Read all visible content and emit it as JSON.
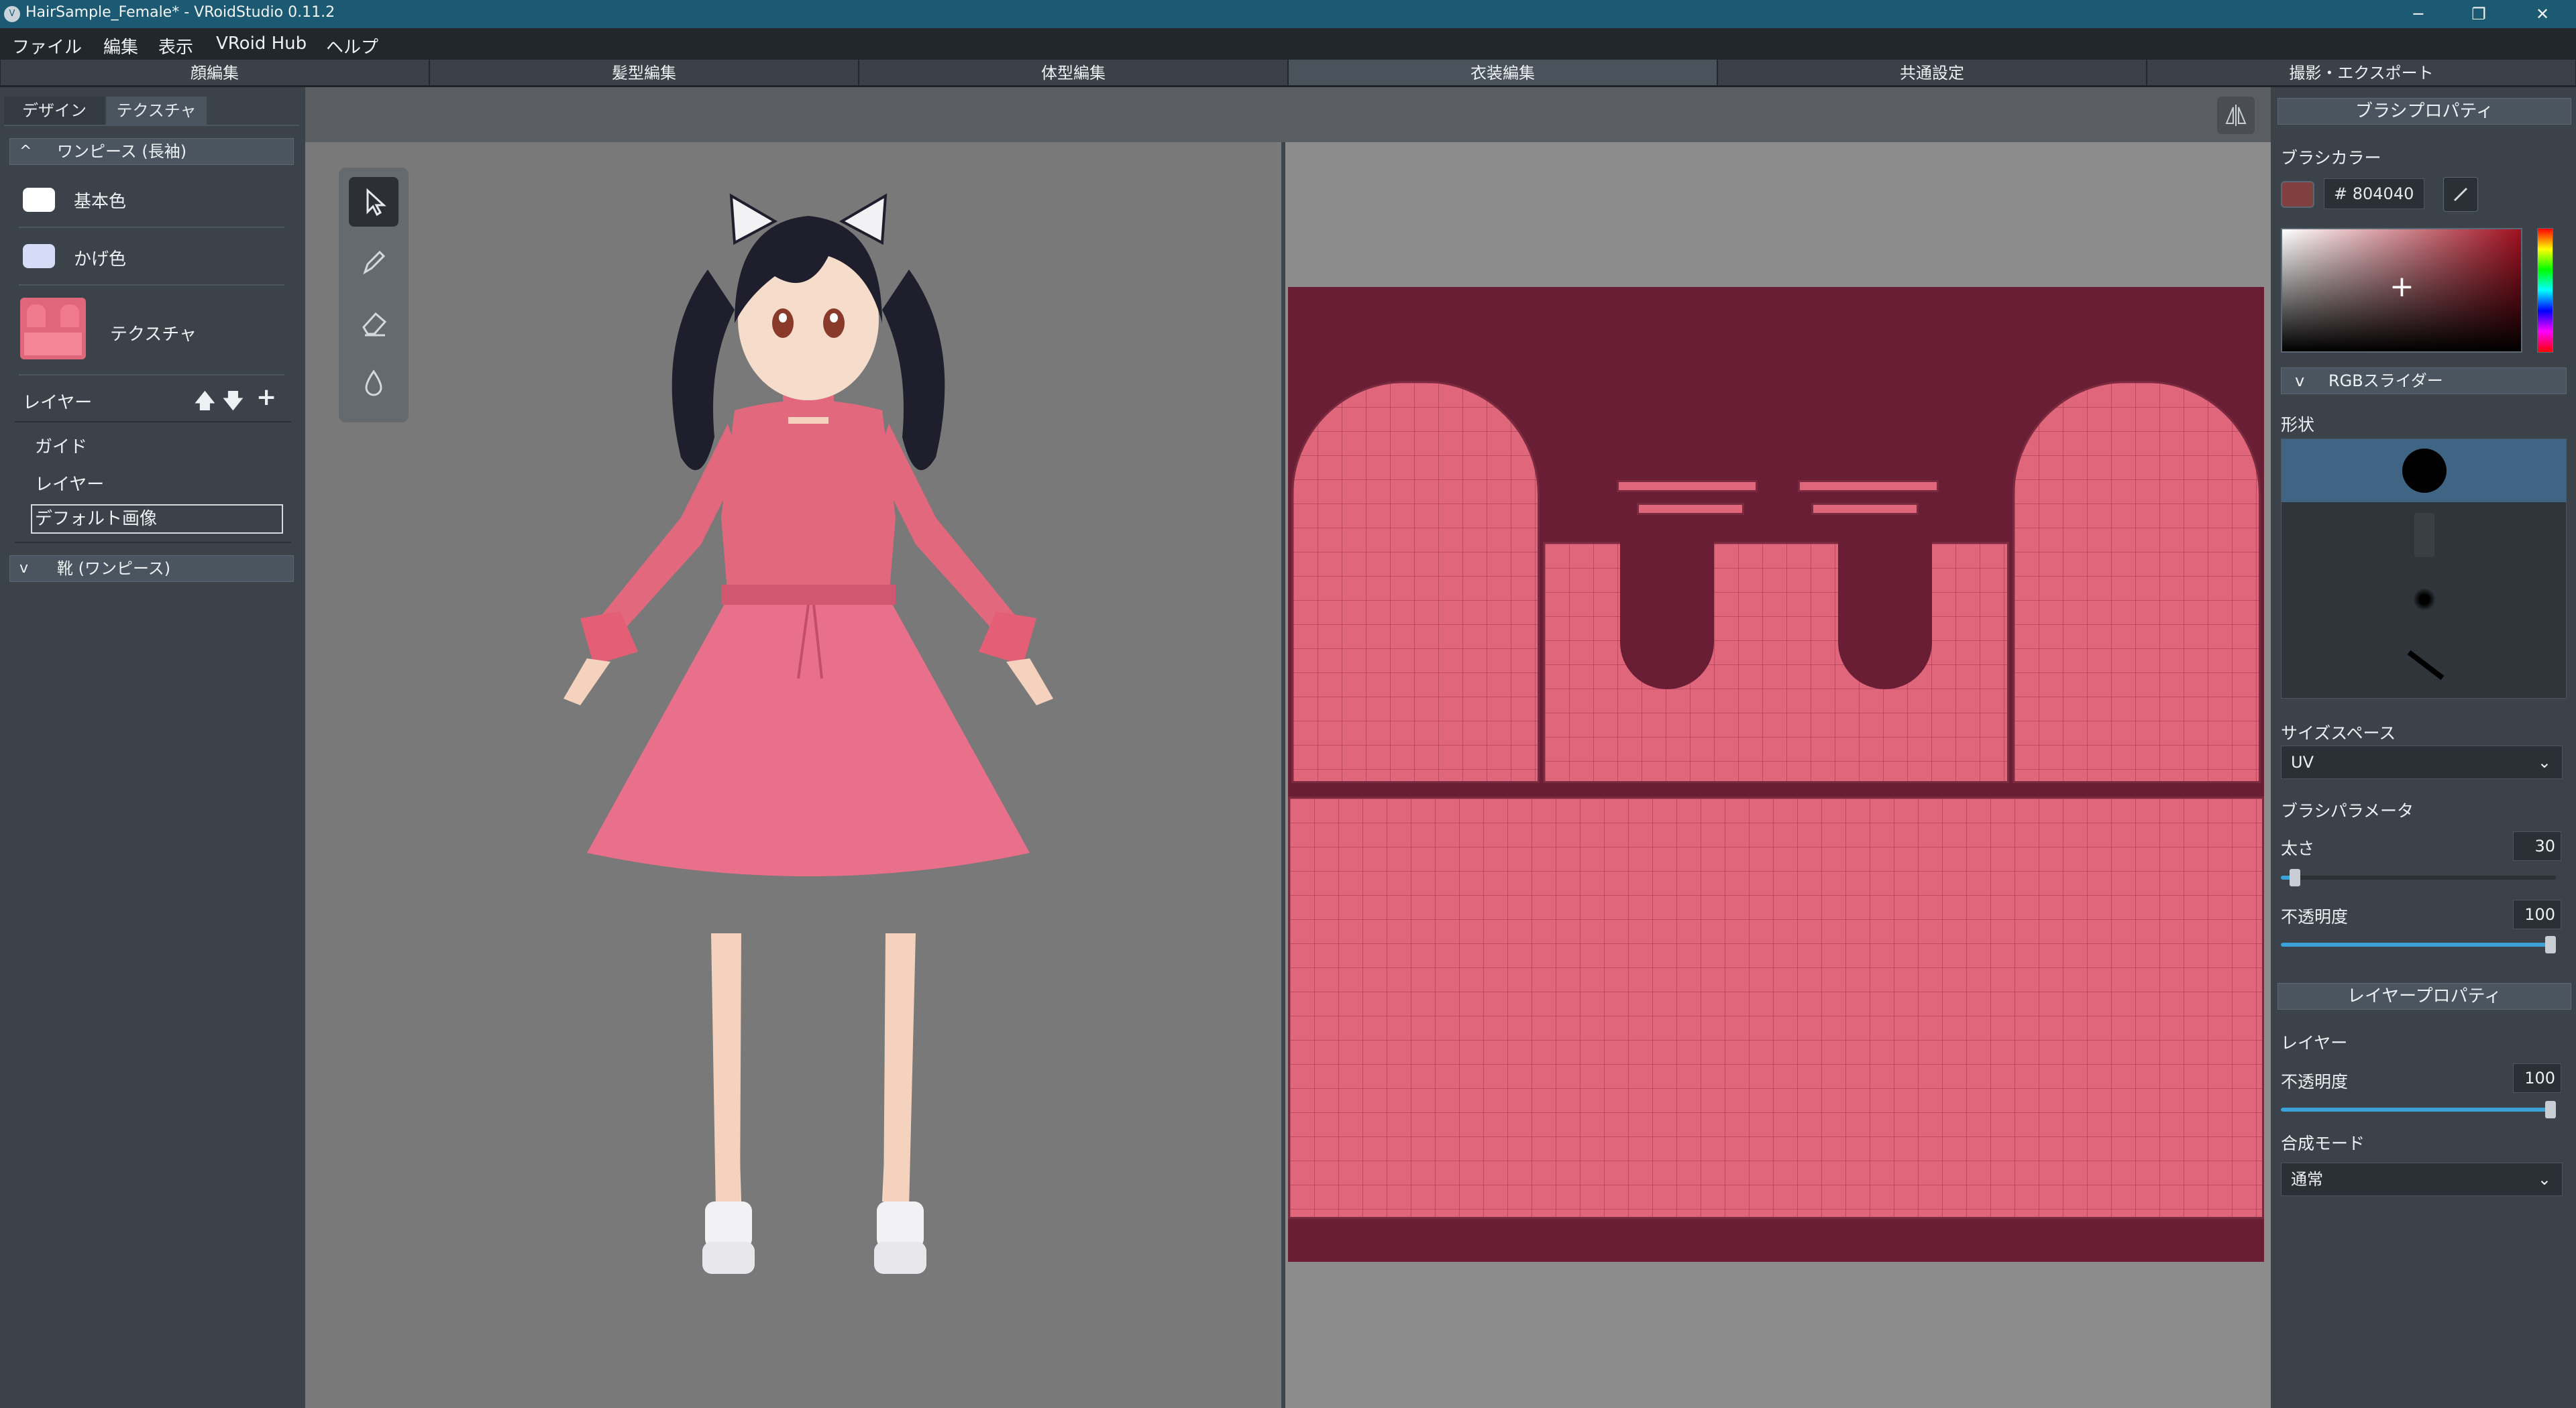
{
  "window": {
    "title": "HairSample_Female* - VRoidStudio 0.11.2",
    "app_icon_glyph": "V",
    "controls": {
      "minimize": "─",
      "maximize": "❐",
      "close": "✕"
    }
  },
  "menubar": [
    "ファイル",
    "編集",
    "表示",
    "VRoid Hub",
    "ヘルプ"
  ],
  "mode_tabs": [
    "顔編集",
    "髪型編集",
    "体型編集",
    "衣装編集",
    "共通設定",
    "撮影・エクスポート"
  ],
  "left_panel": {
    "subtabs": [
      "デザイン",
      "テクスチャ"
    ],
    "section_onepiece": {
      "chevron": "^",
      "title": "ワンピース (長袖)"
    },
    "base_color": {
      "label": "基本色",
      "color": "#ffffff"
    },
    "shade_color": {
      "label": "かげ色",
      "color": "#d6dcf6"
    },
    "texture": {
      "label": "テクスチャ"
    },
    "layers": {
      "label": "レイヤー",
      "up": "🡅",
      "down": "🡇",
      "add": "+",
      "items": [
        "ガイド",
        "レイヤー",
        "デフォルト画像"
      ]
    },
    "section_shoes": {
      "chevron": "v",
      "title": "靴 (ワンピース)"
    }
  },
  "tools": [
    "select-tool",
    "pen-tool",
    "eraser-tool",
    "fill-tool"
  ],
  "right_panel": {
    "brush_properties": {
      "header": "ブラシプロパティ",
      "brush_color_label": "ブラシカラー",
      "color_hex": "# 804040",
      "color": "#804040",
      "rgb_slider_chevron": "v",
      "rgb_slider_label": "RGBスライダー",
      "shape_label": "形状",
      "size_space_label": "サイズスペース",
      "size_space_value": "UV",
      "brush_params_label": "ブラシパラメータ",
      "thickness_label": "太さ",
      "thickness_value": "30",
      "thickness": 0.05,
      "opacity_label": "不透明度",
      "opacity_value": "100",
      "opacity": 1.0,
      "picker_plus": "+",
      "caret": "⌄"
    },
    "layer_properties": {
      "header": "レイヤープロパティ",
      "layer_label": "レイヤー",
      "opacity_label": "不透明度",
      "opacity_value": "100",
      "opacity": 1.0,
      "blend_mode_label": "合成モード",
      "blend_mode_value": "通常"
    }
  },
  "colors": {
    "accent": "#3aa2d8",
    "dress": "#e0667c",
    "uv_background": "#6a1e36",
    "hair": "#1e1e2c"
  }
}
